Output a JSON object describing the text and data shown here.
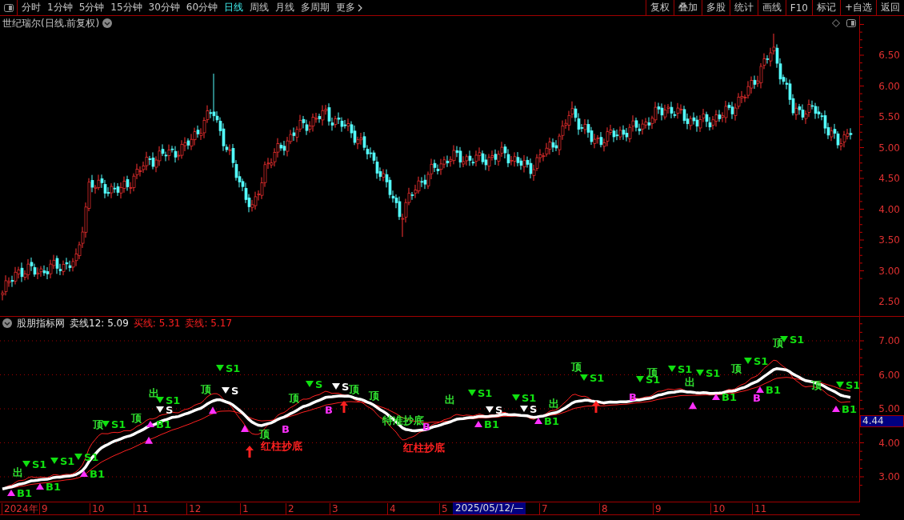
{
  "toolbar": {
    "periods": [
      {
        "label": "分时",
        "selected": false
      },
      {
        "label": "1分钟",
        "selected": false
      },
      {
        "label": "5分钟",
        "selected": false
      },
      {
        "label": "15分钟",
        "selected": false
      },
      {
        "label": "30分钟",
        "selected": false
      },
      {
        "label": "60分钟",
        "selected": false
      },
      {
        "label": "日线",
        "selected": true
      },
      {
        "label": "周线",
        "selected": false
      },
      {
        "label": "月线",
        "selected": false
      },
      {
        "label": "多周期",
        "selected": false
      },
      {
        "label": "更多",
        "selected": false
      }
    ],
    "actions": [
      "复权",
      "叠加",
      "多股",
      "统计",
      "画线",
      "F10",
      "标记",
      "+自选",
      "返回"
    ]
  },
  "price_chart": {
    "title": "世纪瑞尔(日线.前复权)",
    "axis_ticks": [
      "6.50",
      "6.00",
      "5.50",
      "5.00",
      "4.50",
      "4.00",
      "3.50",
      "3.00",
      "2.50"
    ]
  },
  "indicator": {
    "name": "股朋指标网",
    "legend": [
      {
        "label": "卖线12: 5.09",
        "color": "#e8e8e8"
      },
      {
        "label": "买线: 5.31",
        "color": "#ff2020"
      },
      {
        "label": "卖线: 5.17",
        "color": "#ff2020"
      }
    ],
    "axis_ticks": [
      "7.00",
      "6.00",
      "5.00",
      "4.00",
      "3.00"
    ],
    "current_value": "4.44",
    "markers": [
      {
        "kind": "out",
        "label": "出"
      },
      {
        "kind": "sell",
        "label": "S1"
      },
      {
        "kind": "buy",
        "label": "B1"
      },
      {
        "kind": "buy",
        "label": "B1"
      },
      {
        "kind": "sell",
        "label": "S1"
      },
      {
        "kind": "sell",
        "label": "S1"
      },
      {
        "kind": "buy",
        "label": "B1"
      },
      {
        "kind": "top",
        "label": "顶"
      },
      {
        "kind": "sell",
        "label": "S1"
      },
      {
        "kind": "buy",
        "label": "B1"
      },
      {
        "kind": "top",
        "label": "顶"
      },
      {
        "kind": "out",
        "label": "出"
      },
      {
        "kind": "sell",
        "label": "S1"
      },
      {
        "kind": "exit",
        "label": "S"
      },
      {
        "kind": "sell",
        "label": "S1"
      },
      {
        "kind": "top",
        "label": "顶"
      },
      {
        "kind": "exit",
        "label": "S"
      },
      {
        "kind": "top",
        "label": "顶"
      },
      {
        "kind": "arrow"
      },
      {
        "kind": "top",
        "label": "顶"
      },
      {
        "kind": "buyb",
        "label": "B"
      },
      {
        "kind": "red",
        "label": "红柱抄底"
      },
      {
        "kind": "sell",
        "label": "S"
      },
      {
        "kind": "exit",
        "label": "S"
      },
      {
        "kind": "top",
        "label": "顶"
      },
      {
        "kind": "buyb",
        "label": "B"
      },
      {
        "kind": "arrow"
      },
      {
        "kind": "top",
        "label": "顶"
      },
      {
        "kind": "special",
        "label": "特准抄底"
      },
      {
        "kind": "buyb",
        "label": "B"
      },
      {
        "kind": "red",
        "label": "红柱抄底"
      },
      {
        "kind": "out",
        "label": "出"
      },
      {
        "kind": "sell",
        "label": "S1"
      },
      {
        "kind": "exit",
        "label": "S"
      },
      {
        "kind": "sell",
        "label": "S1"
      },
      {
        "kind": "exit",
        "label": "S"
      },
      {
        "kind": "buy",
        "label": "B1"
      },
      {
        "kind": "buy",
        "label": "B1"
      },
      {
        "kind": "top",
        "label": "顶"
      },
      {
        "kind": "sell",
        "label": "S1"
      },
      {
        "kind": "arrow"
      },
      {
        "kind": "out",
        "label": "出"
      },
      {
        "kind": "buyb",
        "label": "B"
      },
      {
        "kind": "sell",
        "label": "S1"
      },
      {
        "kind": "top",
        "label": "顶"
      },
      {
        "kind": "sell",
        "label": "S1"
      },
      {
        "kind": "out",
        "label": "出"
      },
      {
        "kind": "sell",
        "label": "S1"
      },
      {
        "kind": "buy",
        "label": "B1"
      },
      {
        "kind": "top",
        "label": "顶"
      },
      {
        "kind": "sell",
        "label": "S1"
      },
      {
        "kind": "buyb",
        "label": "B"
      },
      {
        "kind": "buy",
        "label": "B1"
      },
      {
        "kind": "top",
        "label": "顶"
      },
      {
        "kind": "sell",
        "label": "S1"
      },
      {
        "kind": "top",
        "label": "顶"
      },
      {
        "kind": "sell",
        "label": "S1"
      },
      {
        "kind": "buy",
        "label": "B1"
      }
    ]
  },
  "time_axis": {
    "labels": [
      "2024年",
      "9",
      "10",
      "11",
      "12",
      "1",
      "2",
      "3",
      "4",
      "5",
      "7",
      "8",
      "9",
      "10",
      "11"
    ],
    "cursor_date": "2025/05/12/—"
  }
}
